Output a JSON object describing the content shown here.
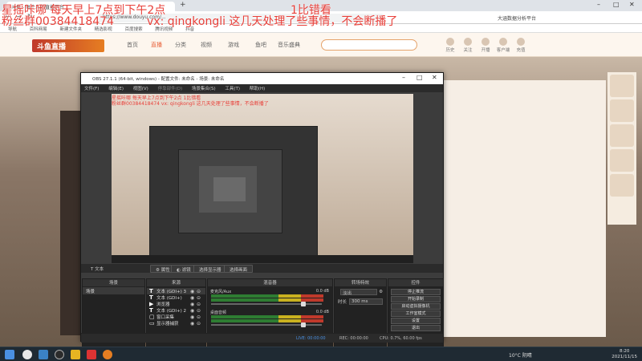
{
  "overlay": {
    "line1_left": "星摇咔哪 每天早上7点到下午2点",
    "line1_right": "1比错看",
    "line2_left": "粉丝群0038441847​4",
    "line2_right": "vx: qingkongli  这几天处理了些事情，不会断播了"
  },
  "browser": {
    "tab_title": "斗鱼 - 每个人的直播平台",
    "url": "https://www.douyu.com/...",
    "new_tab": "+",
    "bookmark_right": "大涵数据分析平台",
    "bookmarks": [
      "导航",
      "百科网易",
      "新建文件夹",
      "精选影视",
      "百度搜索",
      "腾讯视频",
      "抖音"
    ]
  },
  "douyu": {
    "logo": "斗鱼直播",
    "nav": [
      "首页",
      "直播",
      "分类",
      "视频",
      "游戏",
      "鱼吧",
      "音乐盛典"
    ],
    "icons": [
      "历史",
      "关注",
      "开播",
      "客户端",
      "充值"
    ]
  },
  "obs": {
    "title": "OBS 27.1.1 (64-bit, windows) - 配置文件: 未命名 - 场景: 未命名",
    "menu": [
      "文件(F)",
      "编辑(E)",
      "视图(V)",
      "停靠部件(D)",
      "场景集合(S)",
      "工具(T)",
      "帮助(H)"
    ],
    "preview_overlay_1": "星摇咔哪 每天早上7点到下午2点  1比错看",
    "preview_overlay_2": "粉丝群003844184​74  vx: qingkongli 这几天处理了些事情，不会断播了",
    "transition_bar": {
      "source_label": "文本",
      "properties": "属性",
      "filters": "滤镜",
      "select_window": "选择显示器",
      "select_source": "选择画面"
    },
    "docks": {
      "scenes": {
        "title": "场景",
        "items": [
          "场景"
        ]
      },
      "sources": {
        "title": "来源",
        "items": [
          {
            "icon": "T",
            "label": "文本 (GDI+) 3"
          },
          {
            "icon": "T",
            "label": "文本 (GDI+)"
          },
          {
            "icon": "▶",
            "label": "浏览器"
          },
          {
            "icon": "T",
            "label": "文本 (GDI+) 2"
          },
          {
            "icon": "▢",
            "label": "窗口采集"
          },
          {
            "icon": "▭",
            "label": "显示器捕获"
          }
        ]
      },
      "mixer": {
        "title": "混音器",
        "tracks": [
          {
            "name": "麦克风/Aux",
            "db": "0.0 dB",
            "level": 0.85
          },
          {
            "name": "桌面音频",
            "db": "0.0 dB",
            "level": 0.85
          }
        ]
      },
      "transitions": {
        "title": "转场特效",
        "type": "淡出",
        "duration_label": "时长",
        "duration": "300 ms"
      },
      "controls": {
        "title": "控件",
        "buttons": [
          "停止推流",
          "开始录制",
          "启动虚拟摄像机",
          "工作室模式",
          "设置",
          "退出"
        ]
      }
    },
    "status": {
      "live": "LIVE: 00:00:00",
      "rec": "REC: 00:00:00",
      "cpu": "CPU: 0.7%, 60.00 fps"
    }
  },
  "taskbar": {
    "weather": "10°C 阴晴",
    "time": "8:20",
    "date": "2021/11/15"
  }
}
